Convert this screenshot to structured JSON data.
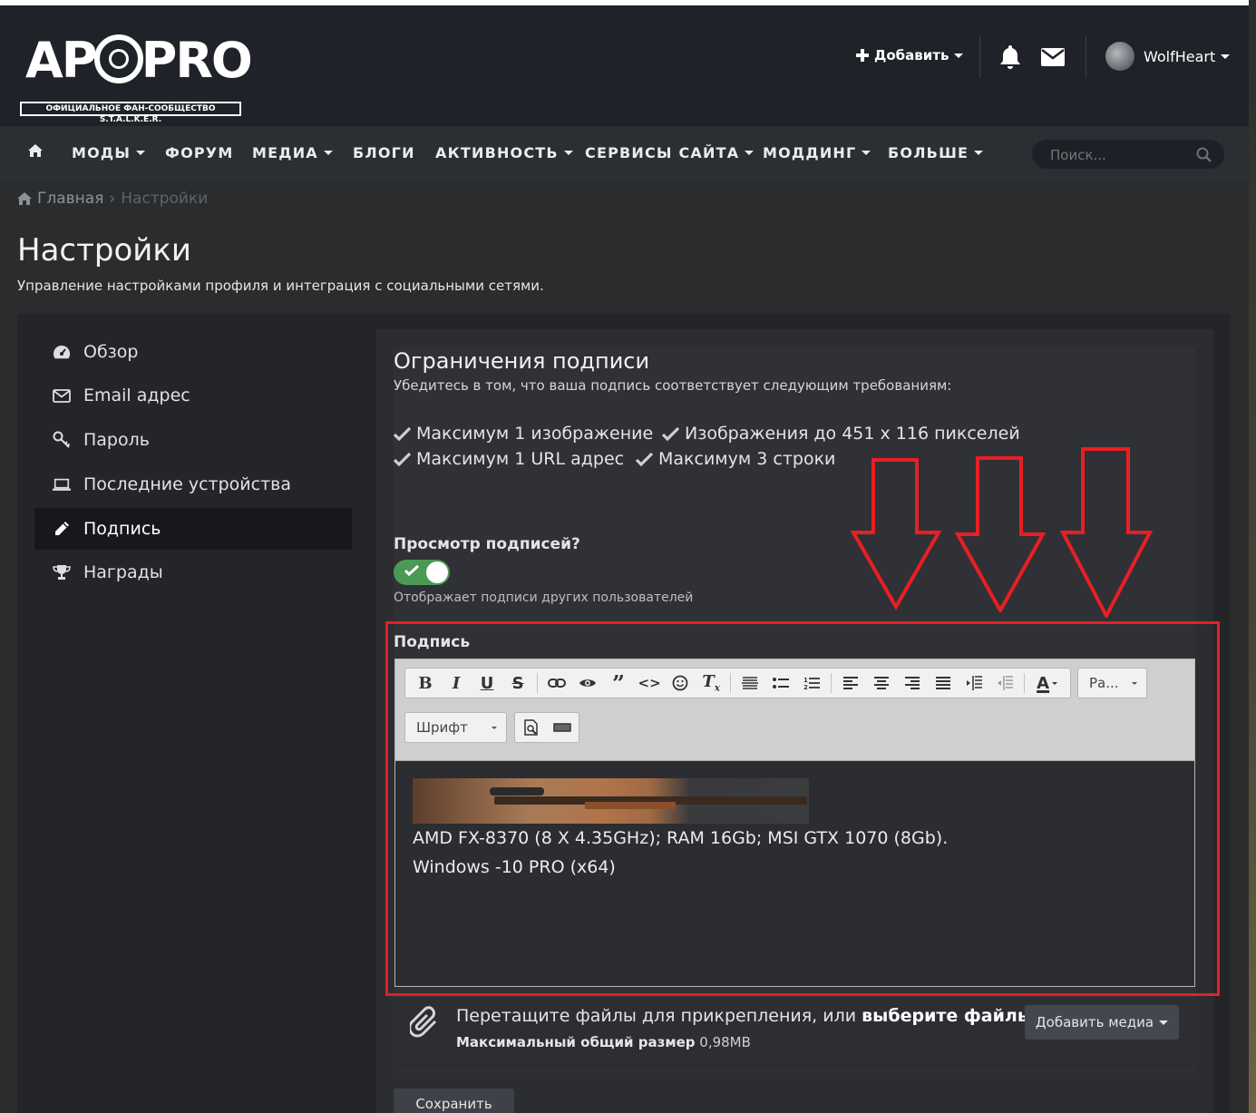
{
  "brand": {
    "logo_text": "AP PRO",
    "logo_subtitle": "ОФИЦИАЛЬНОЕ ФАН-СООБЩЕСТВО S.T.A.L.K.E.R."
  },
  "header": {
    "add_label": "Добавить",
    "username": "WolfHeart"
  },
  "nav": {
    "items": [
      "МОДЫ",
      "ФОРУМ",
      "МЕДИА",
      "БЛОГИ",
      "АКТИВНОСТЬ",
      "СЕРВИСЫ САЙТА",
      "МОДДИНГ",
      "БОЛЬШЕ"
    ],
    "search_placeholder": "Поиск..."
  },
  "breadcrumb": {
    "home": "Главная",
    "current": "Настройки"
  },
  "page": {
    "title": "Настройки",
    "subtitle": "Управление настройками профиля и интеграция с социальными сетями."
  },
  "sidebar": {
    "items": [
      {
        "label": "Обзор",
        "icon": "dashboard-icon"
      },
      {
        "label": "Email адрес",
        "icon": "envelope-icon"
      },
      {
        "label": "Пароль",
        "icon": "key-icon"
      },
      {
        "label": "Последние устройства",
        "icon": "laptop-icon"
      },
      {
        "label": "Подпись",
        "icon": "pencil-icon",
        "active": true
      },
      {
        "label": "Награды",
        "icon": "trophy-icon"
      }
    ]
  },
  "signature": {
    "limits_title": "Ограничения подписи",
    "limits_note": "Убедитесь в том, что ваша подпись соответствует следующим требованиям:",
    "requirements": [
      "Максимум 1 изображение",
      "Изображения до 451 x 116 пикселей",
      "Максимум 1 URL адрес",
      "Максимум 3 строки"
    ],
    "view_label": "Просмотр подписей?",
    "view_enabled": true,
    "view_desc": "Отображает подписи других пользователей",
    "editor_label": "Подпись",
    "editor_lines": [
      "AMD FX-8370 (8 X 4.35GHz); RAM 16Gb; MSI GTX 1070 (8Gb).",
      "Windows -10 PRO (x64)"
    ],
    "size_combo": "Ра...",
    "font_combo": "Шрифт"
  },
  "attach": {
    "text_prefix": "Перетащите файлы для прикрепления, или",
    "choose_link": "выберите файлы ...",
    "size_label": "Максимальный общий размер",
    "size_value": "0,98MB",
    "add_media": "Добавить медиа"
  },
  "save_label": "Сохранить",
  "colors": {
    "accent_toggle": "#4a9a55",
    "annotation_red": "#e81f24",
    "header_bg": "#1f2228",
    "nav_bg": "#2b2e33"
  }
}
